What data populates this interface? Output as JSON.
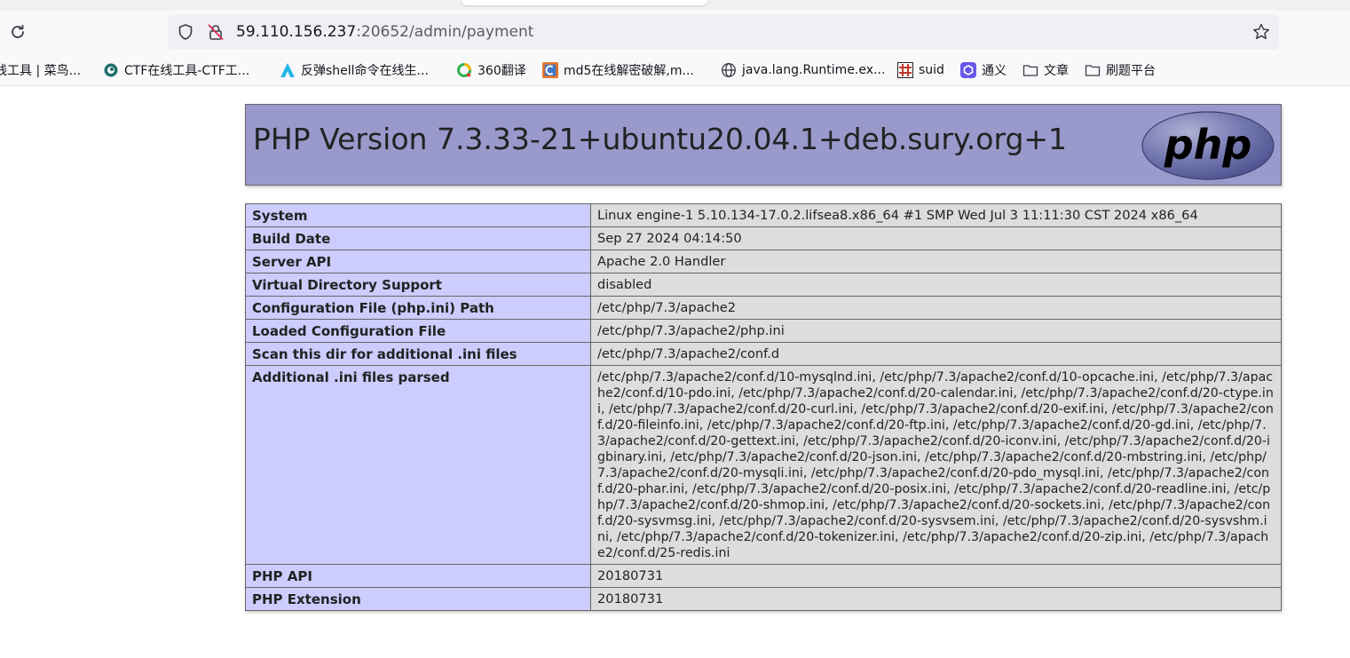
{
  "browser": {
    "url_host": "59.110.156.237",
    "url_path": ":20652/admin/payment",
    "bookmarks": [
      {
        "label": "线工具 | 菜鸟...",
        "icon": "none"
      },
      {
        "label": "CTF在线工具-CTF工...",
        "icon": "ctf-tools-icon"
      },
      {
        "label": "反弹shell命令在线生...",
        "icon": "reverse-shell-icon"
      },
      {
        "label": "360翻译",
        "icon": "translate-360-icon"
      },
      {
        "label": "md5在线解密破解,m...",
        "icon": "md5-icon"
      },
      {
        "label": "java.lang.Runtime.ex...",
        "icon": "globe-icon"
      },
      {
        "label": "suid",
        "icon": "suid-icon"
      },
      {
        "label": "通义",
        "icon": "tongyi-icon"
      },
      {
        "label": "文章",
        "icon": "folder-icon"
      },
      {
        "label": "刷题平台",
        "icon": "folder-icon"
      }
    ]
  },
  "phpinfo": {
    "version_title": "PHP Version 7.3.33-21+ubuntu20.04.1+deb.sury.org+1",
    "logo_text": "php",
    "rows": [
      {
        "key": "System",
        "value": "Linux engine-1 5.10.134-17.0.2.lifsea8.x86_64 #1 SMP Wed Jul 3 11:11:30 CST 2024 x86_64"
      },
      {
        "key": "Build Date",
        "value": "Sep 27 2024 04:14:50"
      },
      {
        "key": "Server API",
        "value": "Apache 2.0 Handler"
      },
      {
        "key": "Virtual Directory Support",
        "value": "disabled"
      },
      {
        "key": "Configuration File (php.ini) Path",
        "value": "/etc/php/7.3/apache2"
      },
      {
        "key": "Loaded Configuration File",
        "value": "/etc/php/7.3/apache2/php.ini"
      },
      {
        "key": "Scan this dir for additional .ini files",
        "value": "/etc/php/7.3/apache2/conf.d"
      },
      {
        "key": "Additional .ini files parsed",
        "value": "/etc/php/7.3/apache2/conf.d/10-mysqlnd.ini, /etc/php/7.3/apache2/conf.d/10-opcache.ini, /etc/php/7.3/apache2/conf.d/10-pdo.ini, /etc/php/7.3/apache2/conf.d/20-calendar.ini, /etc/php/7.3/apache2/conf.d/20-ctype.ini, /etc/php/7.3/apache2/conf.d/20-curl.ini, /etc/php/7.3/apache2/conf.d/20-exif.ini, /etc/php/7.3/apache2/conf.d/20-fileinfo.ini, /etc/php/7.3/apache2/conf.d/20-ftp.ini, /etc/php/7.3/apache2/conf.d/20-gd.ini, /etc/php/7.3/apache2/conf.d/20-gettext.ini, /etc/php/7.3/apache2/conf.d/20-iconv.ini, /etc/php/7.3/apache2/conf.d/20-igbinary.ini, /etc/php/7.3/apache2/conf.d/20-json.ini, /etc/php/7.3/apache2/conf.d/20-mbstring.ini, /etc/php/7.3/apache2/conf.d/20-mysqli.ini, /etc/php/7.3/apache2/conf.d/20-pdo_mysql.ini, /etc/php/7.3/apache2/conf.d/20-phar.ini, /etc/php/7.3/apache2/conf.d/20-posix.ini, /etc/php/7.3/apache2/conf.d/20-readline.ini, /etc/php/7.3/apache2/conf.d/20-shmop.ini, /etc/php/7.3/apache2/conf.d/20-sockets.ini, /etc/php/7.3/apache2/conf.d/20-sysvmsg.ini, /etc/php/7.3/apache2/conf.d/20-sysvsem.ini, /etc/php/7.3/apache2/conf.d/20-sysvshm.ini, /etc/php/7.3/apache2/conf.d/20-tokenizer.ini, /etc/php/7.3/apache2/conf.d/20-zip.ini, /etc/php/7.3/apache2/conf.d/25-redis.ini"
      },
      {
        "key": "PHP API",
        "value": "20180731"
      },
      {
        "key": "PHP Extension",
        "value": "20180731"
      }
    ]
  },
  "colors": {
    "header_bg": "#9999cc",
    "key_cell_bg": "#ccccff",
    "value_cell_bg": "#dddddd",
    "border": "#666666"
  }
}
